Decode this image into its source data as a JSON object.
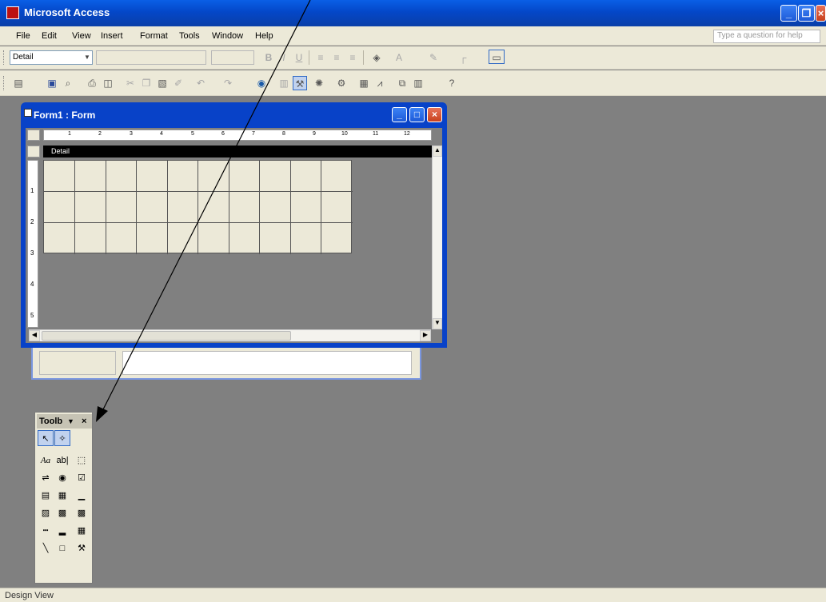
{
  "app": {
    "title": "Microsoft Access"
  },
  "menu": {
    "items": [
      "File",
      "Edit",
      "View",
      "Insert",
      "Format",
      "Tools",
      "Window",
      "Help"
    ],
    "help_placeholder": "Type a question for help"
  },
  "format_toolbar": {
    "object_value": "Detail",
    "bold": "B",
    "italic": "I",
    "underline": "U",
    "font_color": "A"
  },
  "form_window": {
    "title": "Form1 : Form",
    "section_label": "Detail"
  },
  "ruler": {
    "marks": [
      "1",
      "2",
      "3",
      "4",
      "5",
      "6",
      "7",
      "8",
      "9",
      "10",
      "11",
      "12"
    ]
  },
  "vruler": {
    "marks": [
      "1",
      "2",
      "3",
      "4",
      "5"
    ]
  },
  "toolbox": {
    "title": "Toolb",
    "label_tool": "Aa",
    "textbox_tool": "ab|"
  },
  "status": {
    "text": "Design View"
  },
  "colors": {
    "titlebar": "#0a4fd6",
    "workspace": "#808080",
    "chrome": "#ece9d8"
  }
}
